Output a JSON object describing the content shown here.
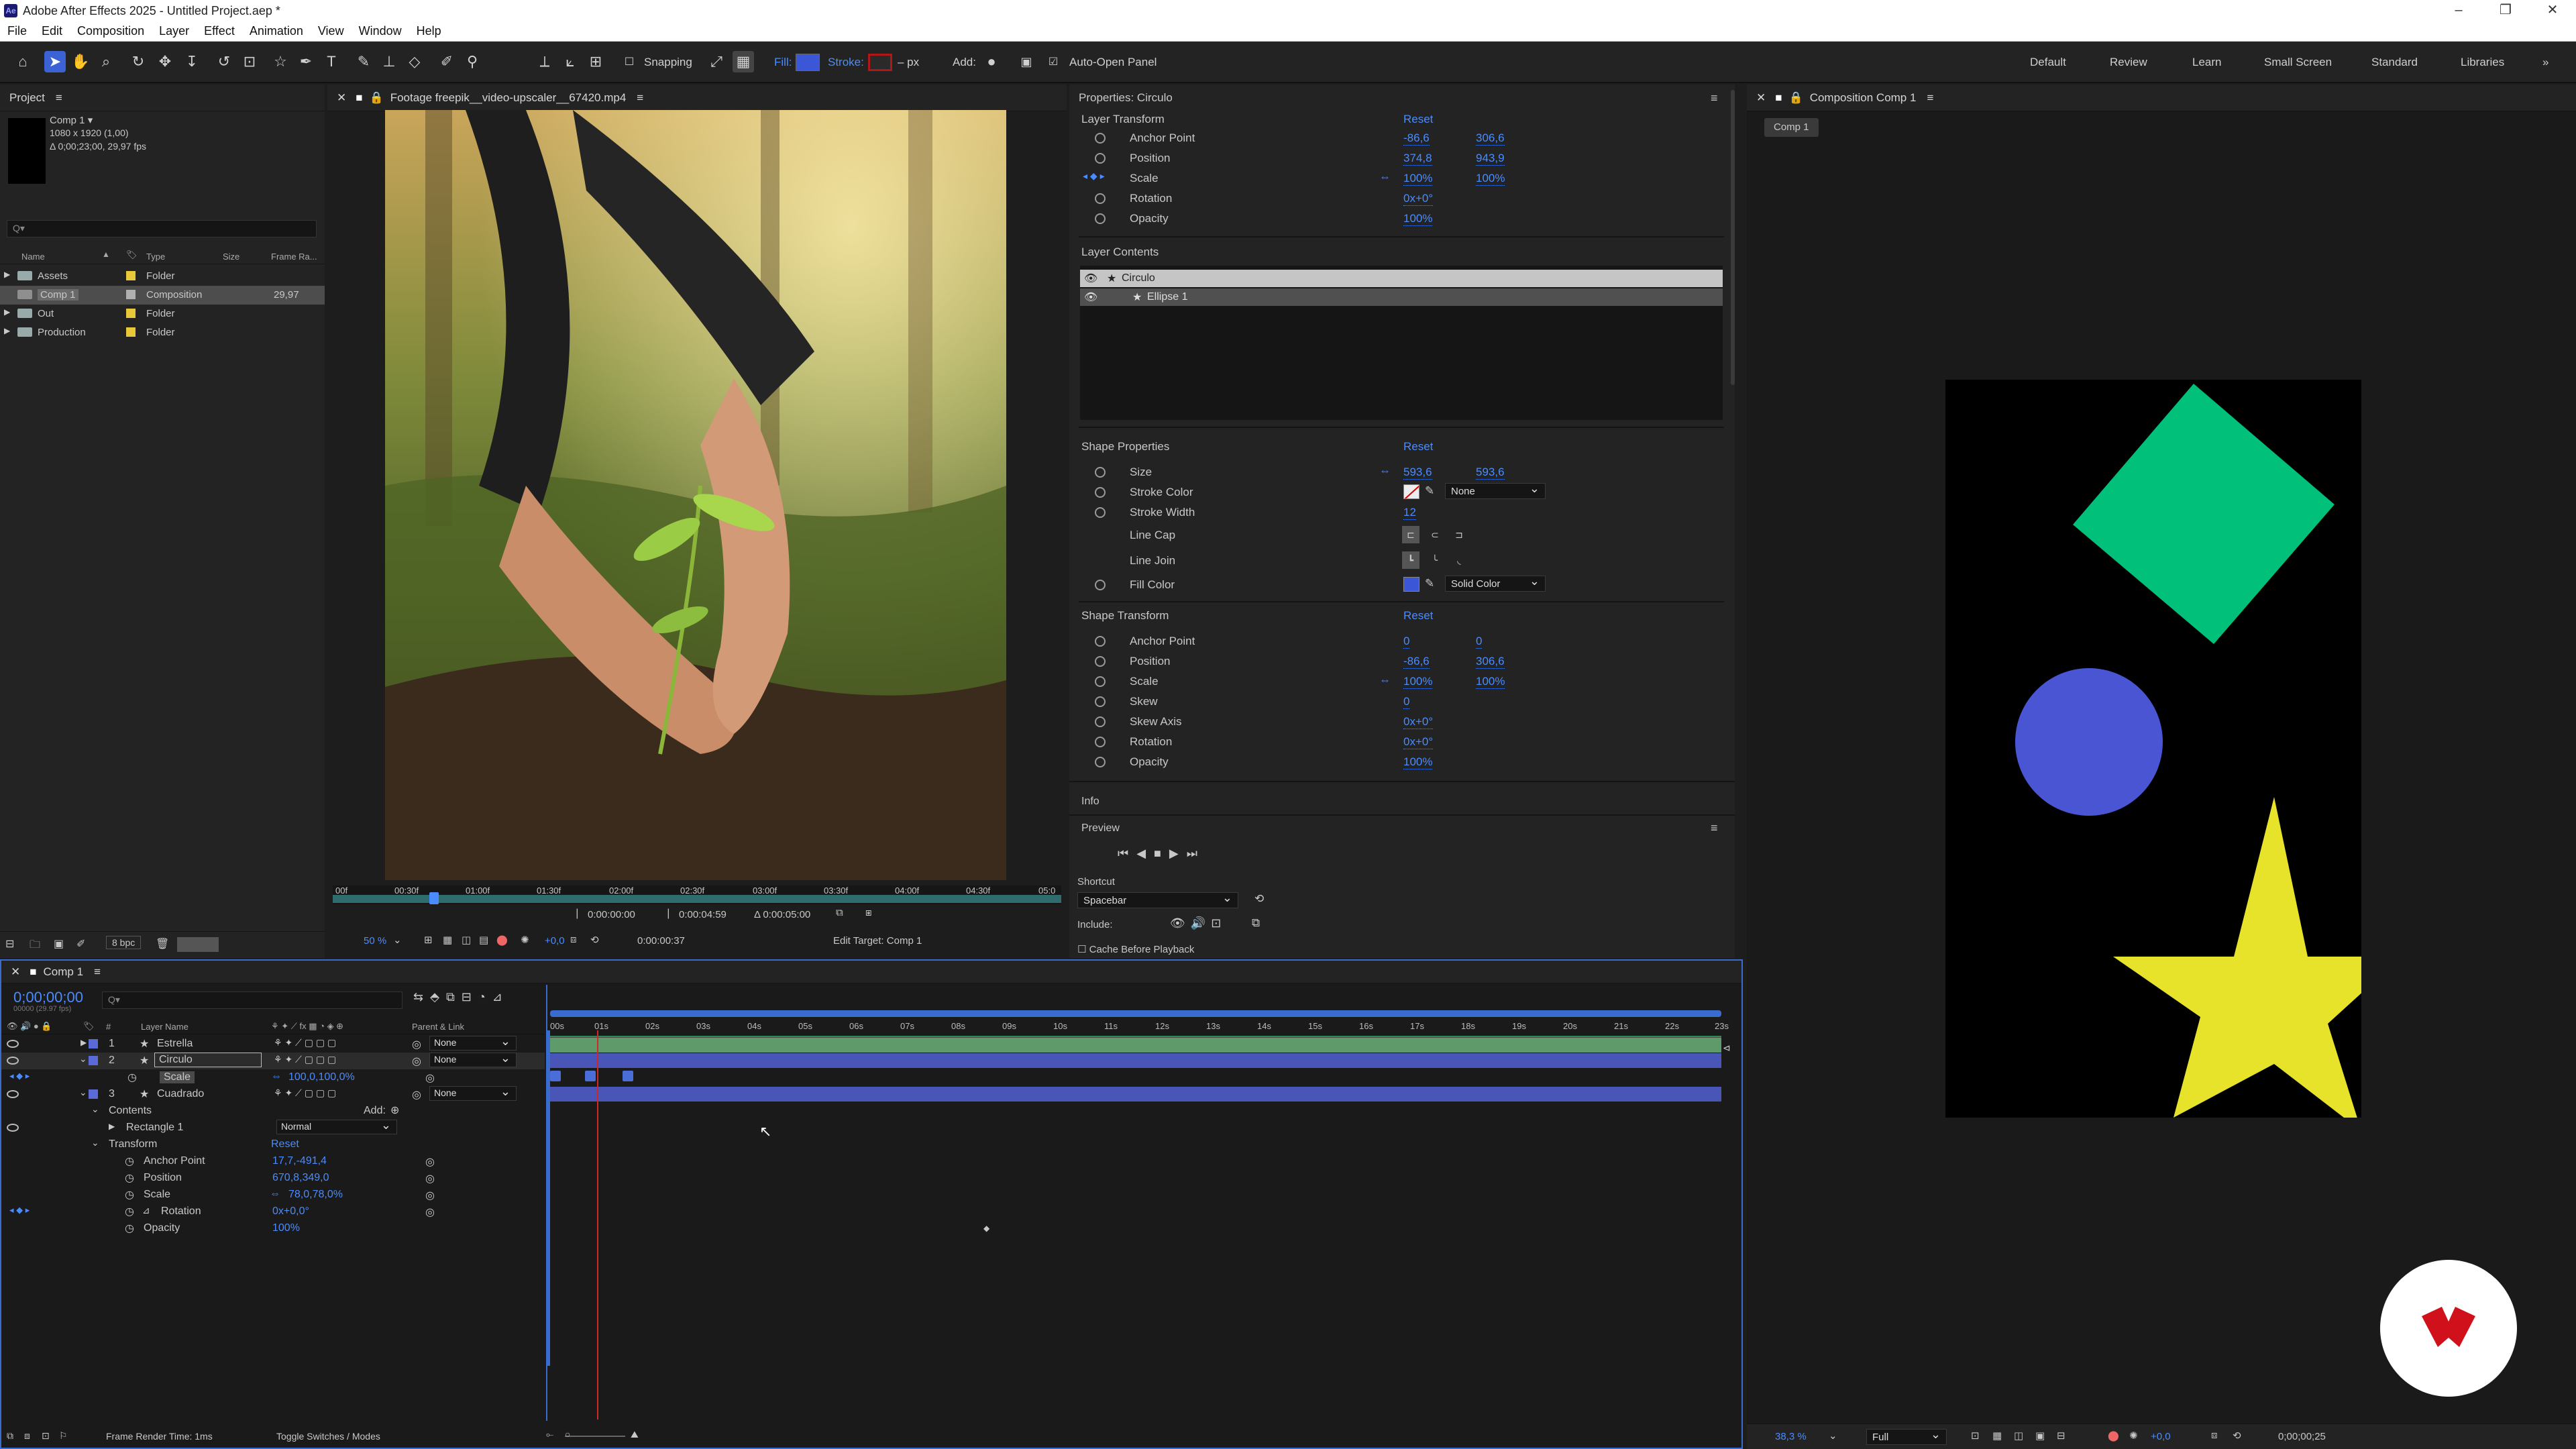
{
  "window": {
    "title": "Adobe After Effects 2025 - Untitled Project.aep *",
    "app_badge": "Ae"
  },
  "menu": [
    "File",
    "Edit",
    "Composition",
    "Layer",
    "Effect",
    "Animation",
    "View",
    "Window",
    "Help"
  ],
  "toolbar": {
    "snapping": "Snapping",
    "fill": "Fill:",
    "stroke": "Stroke:",
    "stroke_px": "– px",
    "add": "Add:",
    "auto_open": "Auto-Open Panel",
    "fill_color": "#3b56d6",
    "stroke_color": "#b01818"
  },
  "workspaces": [
    "Default",
    "Review",
    "Learn",
    "Small Screen",
    "Standard",
    "Libraries"
  ],
  "project": {
    "title": "Project",
    "comp_name": "Comp 1 ▾",
    "comp_size": "1080 x 1920 (1,00)",
    "comp_duration": "Δ 0;00;23;00, 29,97 fps",
    "search_placeholder": "Q▾",
    "columns": [
      "Name",
      "Type",
      "Size",
      "Frame Ra..."
    ],
    "items": [
      {
        "name": "Assets",
        "type": "Folder",
        "fps": ""
      },
      {
        "name": "Comp 1",
        "type": "Composition",
        "fps": "29,97"
      },
      {
        "name": "Out",
        "type": "Folder",
        "fps": ""
      },
      {
        "name": "Production",
        "type": "Folder",
        "fps": ""
      }
    ],
    "bpc": "8 bpc"
  },
  "footage": {
    "tab": "Footage freepik__video-upscaler__67420.mp4",
    "ruler": [
      "00f",
      "00:30f",
      "01:00f",
      "01:30f",
      "02:00f",
      "02:30f",
      "03:00f",
      "03:30f",
      "04:00f",
      "04:30f",
      "05:0"
    ],
    "zoom": "50 %",
    "exposure": "+0,0",
    "current": "0:00:00:37",
    "in": "0:00:00:00",
    "out": "0:00:04:59",
    "duration": "Δ 0:00:05:00",
    "edit_target": "Edit Target: Comp 1"
  },
  "properties": {
    "title": "Properties: Circulo",
    "layer_transform": {
      "label": "Layer Transform",
      "reset": "Reset",
      "rows": [
        {
          "name": "Anchor Point",
          "v1": "-86,6",
          "v2": "306,6"
        },
        {
          "name": "Position",
          "v1": "374,8",
          "v2": "943,9"
        },
        {
          "name": "Scale",
          "v1": "100%",
          "v2": "100%"
        },
        {
          "name": "Rotation",
          "v1": "0x+0°",
          "v2": ""
        },
        {
          "name": "Opacity",
          "v1": "100%",
          "v2": ""
        }
      ]
    },
    "layer_contents": {
      "label": "Layer Contents",
      "items": [
        "Circulo",
        "Ellipse 1"
      ]
    },
    "shape_properties": {
      "label": "Shape Properties",
      "reset": "Reset",
      "size1": "593,6",
      "size2": "593,6",
      "stroke_width": "12",
      "stroke_mode": "None",
      "fill_mode": "Solid Color",
      "labels": [
        "Size",
        "Stroke Color",
        "Stroke Width",
        "Line Cap",
        "Line Join",
        "Fill Color"
      ]
    },
    "shape_transform": {
      "label": "Shape Transform",
      "reset": "Reset",
      "rows": [
        {
          "name": "Anchor Point",
          "v1": "0",
          "v2": "0"
        },
        {
          "name": "Position",
          "v1": "-86,6",
          "v2": "306,6"
        },
        {
          "name": "Scale",
          "v1": "100%",
          "v2": "100%"
        },
        {
          "name": "Skew",
          "v1": "0",
          "v2": ""
        },
        {
          "name": "Skew Axis",
          "v1": "0x+0°",
          "v2": ""
        },
        {
          "name": "Rotation",
          "v1": "0x+0°",
          "v2": ""
        },
        {
          "name": "Opacity",
          "v1": "100%",
          "v2": ""
        }
      ]
    },
    "info": "Info",
    "preview": {
      "label": "Preview",
      "shortcut_label": "Shortcut",
      "shortcut": "Spacebar",
      "include": "Include:",
      "cache": "Cache Before Playback"
    }
  },
  "composition": {
    "title": "Composition Comp 1",
    "tab": "Comp 1",
    "zoom": "38,3 %",
    "res": "Full",
    "exposure": "+0,0",
    "time": "0;00;00;25",
    "shapes": {
      "diamond": "#00c07a",
      "circle": "#4a55d4",
      "star": "#e6e32a"
    }
  },
  "timeline": {
    "comp_tab": "Comp 1",
    "timecode": "0;00;00;00",
    "timecode_sub": "00000 (29.97 fps)",
    "search_placeholder": "Q▾",
    "col_layer": "Layer Name",
    "col_parent": "Parent & Link",
    "col_num": "#",
    "ruler": [
      "00s",
      "01s",
      "02s",
      "03s",
      "04s",
      "05s",
      "06s",
      "07s",
      "08s",
      "09s",
      "10s",
      "11s",
      "12s",
      "13s",
      "14s",
      "15s",
      "16s",
      "17s",
      "18s",
      "19s",
      "20s",
      "21s",
      "22s",
      "23s"
    ],
    "layers": [
      {
        "num": "1",
        "name": "Estrella",
        "parent": "None"
      },
      {
        "num": "2",
        "name": "Circulo",
        "parent": "None"
      },
      {
        "num": "",
        "name": "Scale",
        "value": "100,0,100,0%"
      },
      {
        "num": "3",
        "name": "Cuadrado",
        "parent": "None"
      }
    ],
    "contents": "Contents",
    "add": "Add:",
    "rect": "Rectangle 1",
    "blend": "Normal",
    "transform": "Transform",
    "reset": "Reset",
    "props": [
      {
        "name": "Anchor Point",
        "value": "17,7,-491,4"
      },
      {
        "name": "Position",
        "value": "670,8,349,0"
      },
      {
        "name": "Scale",
        "value": "78,0,78,0%"
      },
      {
        "name": "Rotation",
        "value": "0x+0,0°"
      },
      {
        "name": "Opacity",
        "value": "100%"
      }
    ],
    "render_time": "Frame Render Time: 1ms",
    "toggle": "Toggle Switches / Modes"
  }
}
